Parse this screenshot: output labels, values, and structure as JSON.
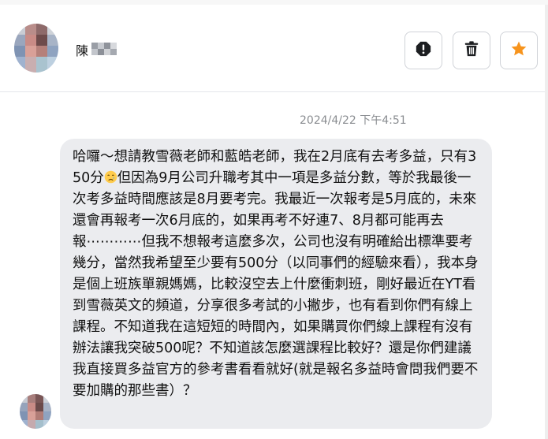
{
  "header": {
    "sender_name": "陳",
    "actions": [
      {
        "icon": "report-icon"
      },
      {
        "icon": "trash-icon"
      },
      {
        "icon": "star-icon"
      }
    ]
  },
  "conversation": {
    "timestamp": "2024/4/22 下午4:51",
    "message": {
      "text_before_emoji": "哈囉～想請教雪薇老師和藍皓老師，我在2月底有去考多益，只有350分",
      "emoji": "crying-face-emoji",
      "text_after_emoji": "但因為9月公司升職考其中一項是多益分數，等於我最後一次考多益時間應該是8月要考完。我最近一次報考是5月底的，未來還會再報考一次6月底的，如果再考不好連7、8月都可能再去報⋯⋯⋯⋯但我不想報考這麼多次，公司也沒有明確給出標準要考幾分，當然我希望至少要有500分（以同事們的經驗來看），我本身是個上班族單親媽媽，比較沒空去上什麼衝刺班，剛好最近在YT看到雪薇英文的頻道，分享很多考試的小撇步，也有看到你們有線上課程。不知道我在這短短的時間內，如果購買你們線上課程有沒有辦法讓我突破500呢？不知道該怎麼選課程比較好？還是你們建議我直接買多益官方的參考書看看就好(就是報名多益時會問我們要不要加購的那些書）？"
    }
  },
  "colors": {
    "bubble_bg": "#ebecef",
    "star_accent": "#f7941d",
    "icon_dark": "#1c1e21",
    "timestamp": "#8a8d91",
    "border": "#d0d3d8"
  }
}
